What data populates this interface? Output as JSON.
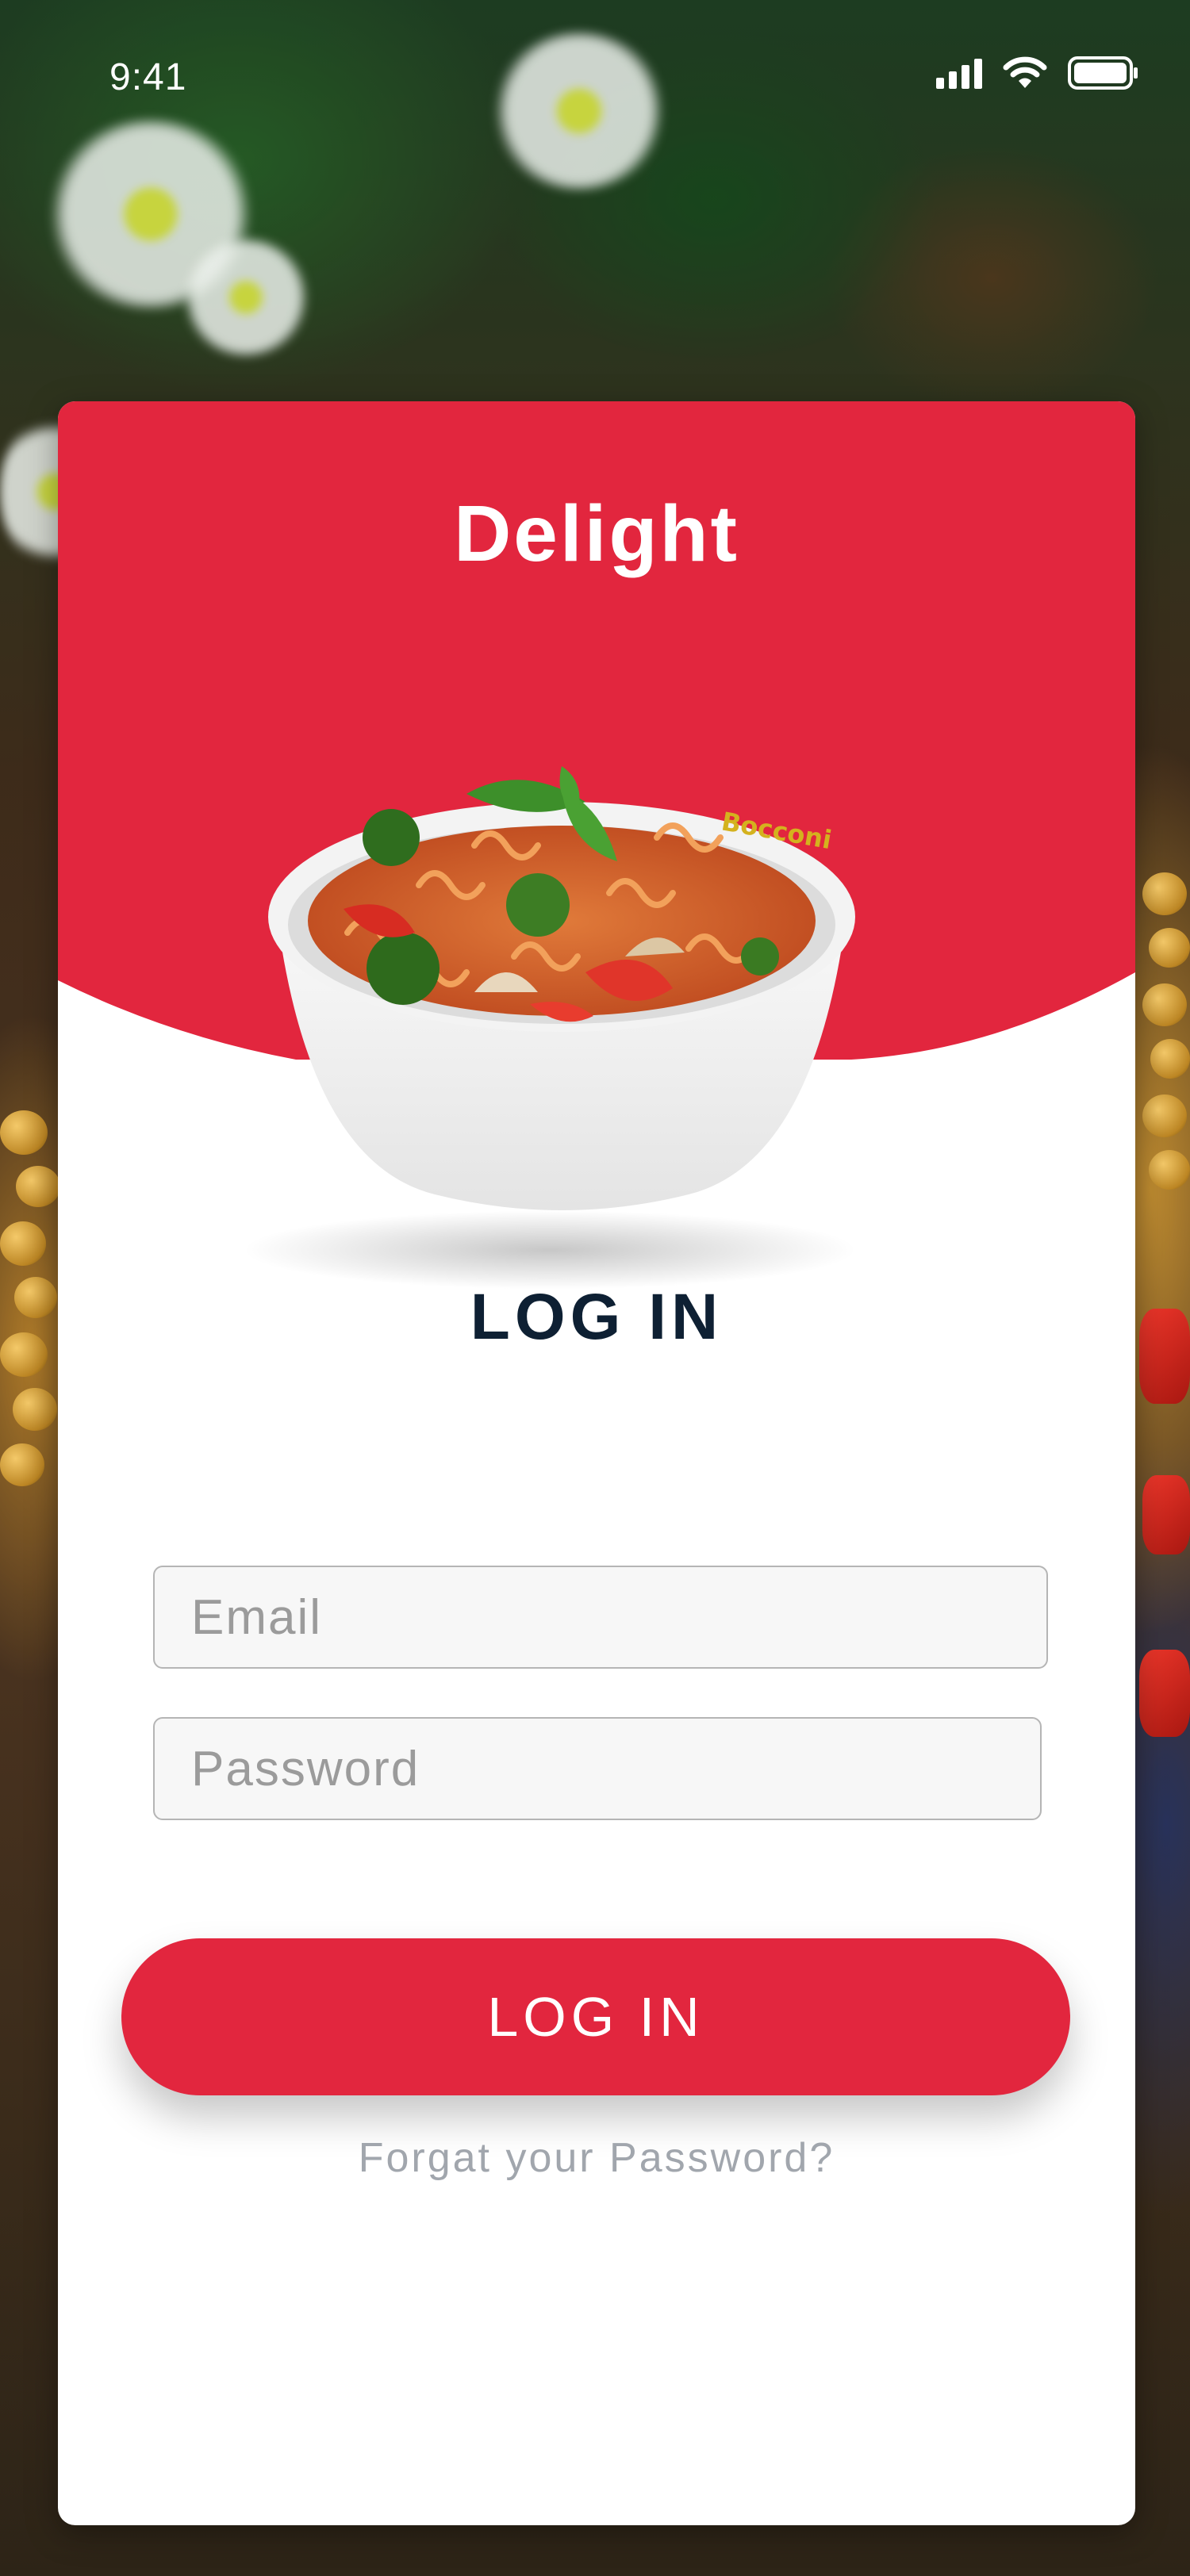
{
  "status_bar": {
    "time": "9:41"
  },
  "app": {
    "title": "Delight"
  },
  "login": {
    "heading": "LOG IN",
    "email_placeholder": "Email",
    "password_placeholder": "Password",
    "button_label": "LOG IN",
    "forgot_link": "Forgat your Password?"
  },
  "colors": {
    "brand_red": "#e2263e",
    "heading_navy": "#0e2033",
    "muted_gray": "#a1a6ad"
  },
  "icons": [
    "signal-icon",
    "wifi-icon",
    "battery-icon"
  ]
}
